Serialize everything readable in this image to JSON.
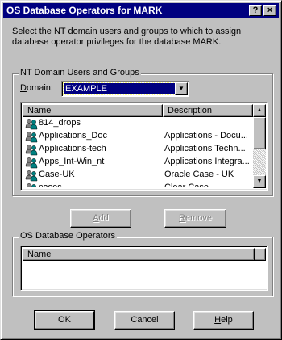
{
  "window": {
    "title": "OS Database Operators for MARK",
    "help_button": "?",
    "close_button": "×"
  },
  "intro_text": "Select the NT domain users and groups to which to assign database operator privileges for the database MARK.",
  "nt_group": {
    "label": "NT Domain Users and Groups",
    "domain_label_accel": "D",
    "domain_label_rest": "omain:",
    "domain_value": "EXAMPLE",
    "columns": {
      "name": "Name",
      "description": "Description"
    },
    "rows": [
      {
        "name": "814_drops",
        "description": ""
      },
      {
        "name": "Applications_Doc",
        "description": "Applications - Docu..."
      },
      {
        "name": "Applications-tech",
        "description": "Applications Techn..."
      },
      {
        "name": "Apps_Int-Win_nt",
        "description": "Applications Integra..."
      },
      {
        "name": "Case-UK",
        "description": "Oracle Case - UK"
      },
      {
        "name": "cases",
        "description": "Clear Case"
      }
    ]
  },
  "add_button": {
    "accel": "A",
    "rest": "dd"
  },
  "remove_button": {
    "accel": "R",
    "rest": "emove"
  },
  "os_group": {
    "label": "OS Database Operators",
    "columns": {
      "name": "Name"
    }
  },
  "ok_button": "OK",
  "cancel_button": "Cancel",
  "help_button": {
    "accel": "H",
    "rest": "elp"
  },
  "colors": {
    "title_bar": "#000080",
    "face": "#c0c0c0",
    "selection": "#000080",
    "icon_primary": "#008080",
    "icon_secondary": "#808080"
  }
}
